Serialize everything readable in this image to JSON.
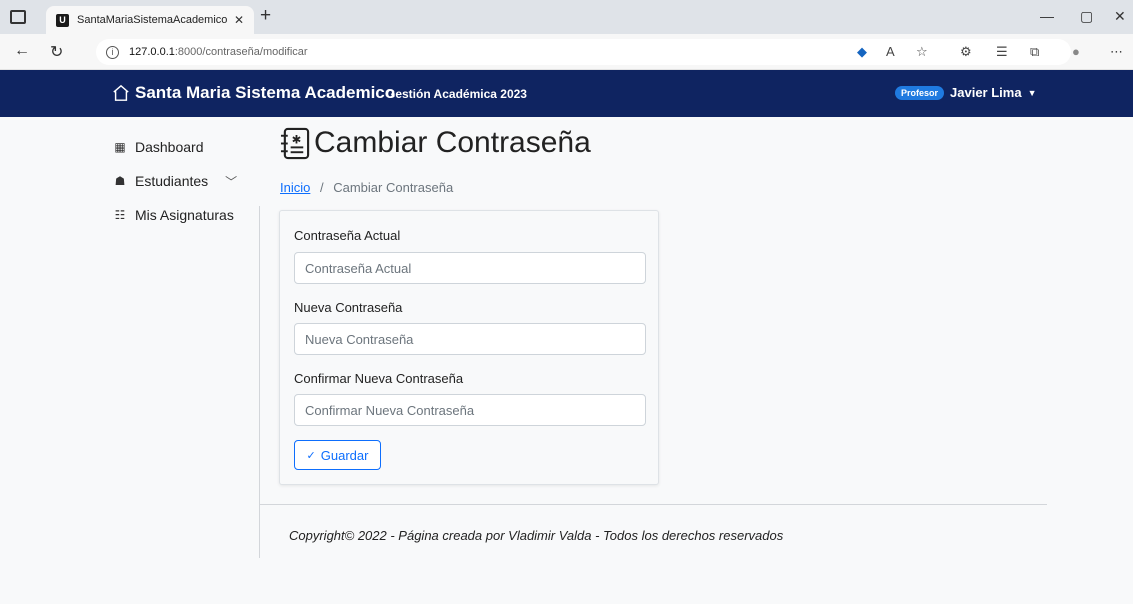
{
  "browser": {
    "tab_title": "SantaMariaSistemaAcademico",
    "tab_favicon_letter": "U",
    "url_host": "127.0.0.1",
    "url_path": ":8000/contraseña/modificar",
    "icons": [
      "tab-actions-icon",
      "close-icon",
      "new-tab-icon",
      "back-icon",
      "refresh-icon",
      "info-icon",
      "tag-icon",
      "read-aloud-icon",
      "favorite-icon",
      "extensions-icon",
      "favorites-list-icon",
      "collections-icon",
      "profile-icon",
      "more-icon",
      "minimize-icon",
      "restore-icon",
      "window-close-icon"
    ]
  },
  "navbar": {
    "brand": "Santa Maria Sistema Academico",
    "subtitle": "Gestión Académica 2023",
    "role_badge": "Profesor",
    "user_name": "Javier Lima",
    "background": "#0f2461"
  },
  "sidebar": {
    "items": [
      {
        "label": "Dashboard",
        "icon": "grid-icon"
      },
      {
        "label": "Estudiantes",
        "icon": "students-icon",
        "expandable": true
      },
      {
        "label": "Mis Asignaturas",
        "icon": "list-icon"
      }
    ]
  },
  "main": {
    "title": "Cambiar Contraseña",
    "breadcrumb": {
      "home": "Inicio",
      "separator": "/",
      "current": "Cambiar Contraseña"
    },
    "form": {
      "current_label": "Contraseña Actual",
      "current_placeholder": "Contraseña Actual",
      "new_label": "Nueva Contraseña",
      "new_placeholder": "Nueva Contraseña",
      "confirm_label": "Confirmar Nueva Contraseña",
      "confirm_placeholder": "Confirmar Nueva Contraseña",
      "save_label": "Guardar"
    }
  },
  "footer": {
    "text": "Copyright© 2022 - Página creada por Vladimir Valda - Todos los derechos reservados"
  },
  "colors": {
    "accent": "#0d6efd",
    "badge": "#1f7ae0"
  }
}
